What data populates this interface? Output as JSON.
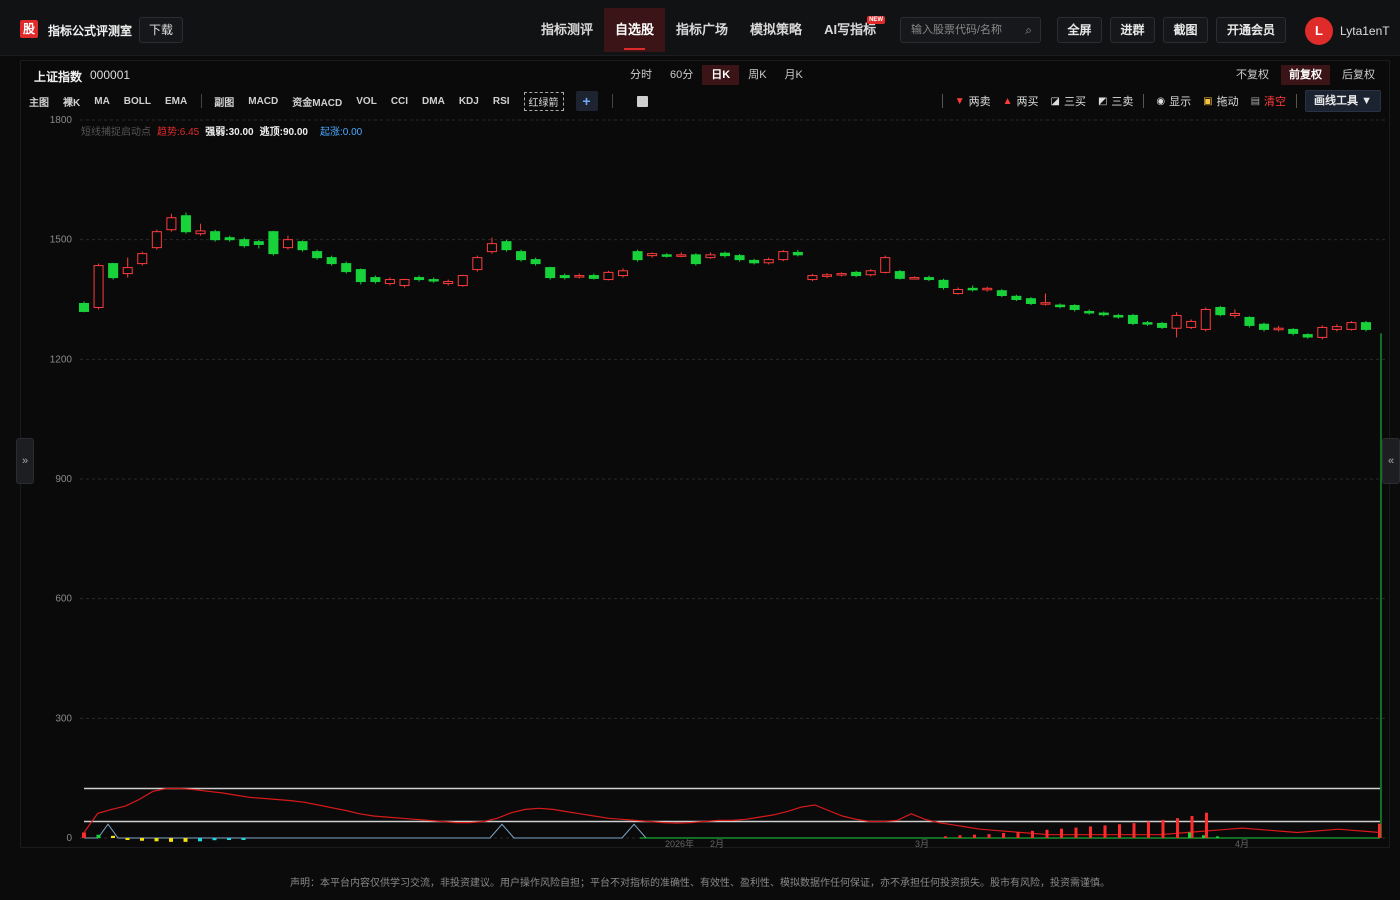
{
  "header": {
    "logo_text": "股",
    "app_title": "指标公式评测室",
    "download_label": "下载",
    "nav": [
      {
        "label": "指标测评",
        "active": false,
        "badge": ""
      },
      {
        "label": "自选股",
        "active": true,
        "badge": ""
      },
      {
        "label": "指标广场",
        "active": false,
        "badge": ""
      },
      {
        "label": "模拟策略",
        "active": false,
        "badge": ""
      },
      {
        "label": "AI写指标",
        "active": false,
        "badge": "NEW"
      }
    ],
    "search_placeholder": "输入股票代码/名称",
    "buttons": {
      "fullscreen": "全屏",
      "join_group": "进群",
      "screenshot": "截图",
      "vip": "开通会员"
    },
    "avatar_letter": "L",
    "username": "Lyta1enT"
  },
  "stock": {
    "name": "上证指数",
    "code": "000001"
  },
  "periods": [
    "分时",
    "60分",
    "日K",
    "周K",
    "月K"
  ],
  "active_period": "日K",
  "adjust": [
    "不复权",
    "前复权",
    "后复权"
  ],
  "active_adjust": "前复权",
  "indicators_main": [
    "主图",
    "裸K",
    "MA",
    "BOLL",
    "EMA"
  ],
  "indicators_sub": [
    "副图",
    "MACD",
    "资金MACD",
    "VOL",
    "CCI",
    "DMA",
    "KDJ",
    "RSI"
  ],
  "indicator_special": "红绿箭",
  "draw_tools": {
    "sell2": "两卖",
    "buy2": "两买",
    "buy3": "三买",
    "sell3": "三卖",
    "show": "显示",
    "drag": "拖动",
    "clear": "清空",
    "tool_btn": "画线工具 ▼"
  },
  "legend": {
    "name": "短线捕捉启动点",
    "trend": "趋势:6.45",
    "strong_weak": "强弱:30.00",
    "top": "逃顶:90.00",
    "hidden": "",
    "rise": "起涨:0.00"
  },
  "colors": {
    "up": "#ff3b3b",
    "down": "#18d23a",
    "accent": "#e02b2b",
    "blue": "#4aa8ff"
  },
  "chart_data": {
    "type": "candlestick",
    "yticks": [
      0,
      300,
      600,
      900,
      1200,
      1500,
      1800
    ],
    "ylim": [
      0,
      1800
    ],
    "x_labels": [
      "2026年",
      "2月",
      "3月",
      "4月"
    ],
    "candles": [
      {
        "o": 1340,
        "c": 1320,
        "h": 1345,
        "l": 1318
      },
      {
        "o": 1330,
        "c": 1435,
        "h": 1440,
        "l": 1325
      },
      {
        "o": 1440,
        "c": 1405,
        "h": 1442,
        "l": 1400
      },
      {
        "o": 1415,
        "c": 1430,
        "h": 1455,
        "l": 1405
      },
      {
        "o": 1440,
        "c": 1465,
        "h": 1470,
        "l": 1435
      },
      {
        "o": 1480,
        "c": 1520,
        "h": 1525,
        "l": 1475
      },
      {
        "o": 1525,
        "c": 1555,
        "h": 1565,
        "l": 1520
      },
      {
        "o": 1560,
        "c": 1520,
        "h": 1568,
        "l": 1515
      },
      {
        "o": 1515,
        "c": 1522,
        "h": 1540,
        "l": 1510
      },
      {
        "o": 1520,
        "c": 1500,
        "h": 1525,
        "l": 1495
      },
      {
        "o": 1505,
        "c": 1500,
        "h": 1510,
        "l": 1495
      },
      {
        "o": 1500,
        "c": 1485,
        "h": 1505,
        "l": 1480
      },
      {
        "o": 1495,
        "c": 1488,
        "h": 1500,
        "l": 1478
      },
      {
        "o": 1520,
        "c": 1465,
        "h": 1522,
        "l": 1460
      },
      {
        "o": 1480,
        "c": 1500,
        "h": 1510,
        "l": 1475
      },
      {
        "o": 1495,
        "c": 1475,
        "h": 1498,
        "l": 1470
      },
      {
        "o": 1470,
        "c": 1455,
        "h": 1475,
        "l": 1450
      },
      {
        "o": 1455,
        "c": 1440,
        "h": 1460,
        "l": 1435
      },
      {
        "o": 1440,
        "c": 1420,
        "h": 1445,
        "l": 1415
      },
      {
        "o": 1425,
        "c": 1395,
        "h": 1428,
        "l": 1388
      },
      {
        "o": 1405,
        "c": 1395,
        "h": 1410,
        "l": 1390
      },
      {
        "o": 1390,
        "c": 1400,
        "h": 1405,
        "l": 1385
      },
      {
        "o": 1385,
        "c": 1400,
        "h": 1402,
        "l": 1380
      },
      {
        "o": 1405,
        "c": 1400,
        "h": 1410,
        "l": 1395
      },
      {
        "o": 1400,
        "c": 1398,
        "h": 1405,
        "l": 1392
      },
      {
        "o": 1390,
        "c": 1395,
        "h": 1400,
        "l": 1385
      },
      {
        "o": 1385,
        "c": 1410,
        "h": 1412,
        "l": 1382
      },
      {
        "o": 1425,
        "c": 1455,
        "h": 1460,
        "l": 1420
      },
      {
        "o": 1470,
        "c": 1490,
        "h": 1505,
        "l": 1465
      },
      {
        "o": 1495,
        "c": 1475,
        "h": 1500,
        "l": 1470
      },
      {
        "o": 1470,
        "c": 1450,
        "h": 1475,
        "l": 1445
      },
      {
        "o": 1450,
        "c": 1440,
        "h": 1455,
        "l": 1435
      },
      {
        "o": 1430,
        "c": 1405,
        "h": 1432,
        "l": 1400
      },
      {
        "o": 1410,
        "c": 1405,
        "h": 1415,
        "l": 1400
      },
      {
        "o": 1408,
        "c": 1410,
        "h": 1415,
        "l": 1403
      },
      {
        "o": 1410,
        "c": 1403,
        "h": 1415,
        "l": 1400
      },
      {
        "o": 1400,
        "c": 1418,
        "h": 1422,
        "l": 1398
      },
      {
        "o": 1410,
        "c": 1422,
        "h": 1428,
        "l": 1405
      },
      {
        "o": 1470,
        "c": 1450,
        "h": 1475,
        "l": 1445
      },
      {
        "o": 1460,
        "c": 1465,
        "h": 1468,
        "l": 1455
      },
      {
        "o": 1462,
        "c": 1460,
        "h": 1466,
        "l": 1455
      },
      {
        "o": 1460,
        "c": 1462,
        "h": 1468,
        "l": 1456
      },
      {
        "o": 1462,
        "c": 1440,
        "h": 1466,
        "l": 1435
      },
      {
        "o": 1455,
        "c": 1462,
        "h": 1468,
        "l": 1452
      },
      {
        "o": 1466,
        "c": 1460,
        "h": 1470,
        "l": 1455
      },
      {
        "o": 1460,
        "c": 1450,
        "h": 1464,
        "l": 1445
      },
      {
        "o": 1448,
        "c": 1442,
        "h": 1452,
        "l": 1438
      },
      {
        "o": 1442,
        "c": 1450,
        "h": 1455,
        "l": 1438
      },
      {
        "o": 1450,
        "c": 1470,
        "h": 1474,
        "l": 1446
      },
      {
        "o": 1468,
        "c": 1462,
        "h": 1474,
        "l": 1458
      },
      {
        "o": 1400,
        "c": 1410,
        "h": 1414,
        "l": 1396
      },
      {
        "o": 1408,
        "c": 1412,
        "h": 1416,
        "l": 1404
      },
      {
        "o": 1412,
        "c": 1415,
        "h": 1418,
        "l": 1408
      },
      {
        "o": 1418,
        "c": 1410,
        "h": 1422,
        "l": 1406
      },
      {
        "o": 1412,
        "c": 1422,
        "h": 1426,
        "l": 1408
      },
      {
        "o": 1418,
        "c": 1455,
        "h": 1460,
        "l": 1415
      },
      {
        "o": 1420,
        "c": 1403,
        "h": 1424,
        "l": 1400
      },
      {
        "o": 1403,
        "c": 1405,
        "h": 1408,
        "l": 1400
      },
      {
        "o": 1405,
        "c": 1400,
        "h": 1410,
        "l": 1396
      },
      {
        "o": 1398,
        "c": 1380,
        "h": 1402,
        "l": 1375
      },
      {
        "o": 1365,
        "c": 1375,
        "h": 1380,
        "l": 1362
      },
      {
        "o": 1378,
        "c": 1375,
        "h": 1385,
        "l": 1370
      },
      {
        "o": 1375,
        "c": 1378,
        "h": 1382,
        "l": 1370
      },
      {
        "o": 1372,
        "c": 1360,
        "h": 1376,
        "l": 1356
      },
      {
        "o": 1358,
        "c": 1350,
        "h": 1362,
        "l": 1346
      },
      {
        "o": 1352,
        "c": 1340,
        "h": 1356,
        "l": 1336
      },
      {
        "o": 1340,
        "c": 1342,
        "h": 1365,
        "l": 1335
      },
      {
        "o": 1336,
        "c": 1332,
        "h": 1340,
        "l": 1328
      },
      {
        "o": 1335,
        "c": 1325,
        "h": 1338,
        "l": 1320
      },
      {
        "o": 1320,
        "c": 1318,
        "h": 1325,
        "l": 1312
      },
      {
        "o": 1316,
        "c": 1312,
        "h": 1320,
        "l": 1308
      },
      {
        "o": 1310,
        "c": 1306,
        "h": 1314,
        "l": 1302
      },
      {
        "o": 1310,
        "c": 1290,
        "h": 1314,
        "l": 1286
      },
      {
        "o": 1292,
        "c": 1290,
        "h": 1296,
        "l": 1284
      },
      {
        "o": 1290,
        "c": 1280,
        "h": 1294,
        "l": 1276
      },
      {
        "o": 1278,
        "c": 1310,
        "h": 1318,
        "l": 1255
      },
      {
        "o": 1280,
        "c": 1295,
        "h": 1300,
        "l": 1276
      },
      {
        "o": 1275,
        "c": 1325,
        "h": 1330,
        "l": 1270
      },
      {
        "o": 1330,
        "c": 1312,
        "h": 1334,
        "l": 1308
      },
      {
        "o": 1310,
        "c": 1315,
        "h": 1325,
        "l": 1304
      },
      {
        "o": 1305,
        "c": 1285,
        "h": 1308,
        "l": 1280
      },
      {
        "o": 1288,
        "c": 1275,
        "h": 1292,
        "l": 1270
      },
      {
        "o": 1275,
        "c": 1278,
        "h": 1284,
        "l": 1270
      },
      {
        "o": 1275,
        "c": 1265,
        "h": 1278,
        "l": 1260
      },
      {
        "o": 1262,
        "c": 1256,
        "h": 1265,
        "l": 1252
      },
      {
        "o": 1255,
        "c": 1280,
        "h": 1285,
        "l": 1250
      },
      {
        "o": 1275,
        "c": 1282,
        "h": 1288,
        "l": 1270
      },
      {
        "o": 1275,
        "c": 1292,
        "h": 1296,
        "l": 1272
      },
      {
        "o": 1292,
        "c": 1275,
        "h": 1296,
        "l": 1270
      }
    ],
    "osc_levels": [
      90,
      30
    ],
    "trend_line": [
      10,
      45,
      52,
      58,
      70,
      85,
      90,
      90,
      88,
      85,
      82,
      78,
      74,
      72,
      70,
      68,
      65,
      60,
      55,
      50,
      44,
      40,
      38,
      36,
      34,
      32,
      30,
      28,
      28,
      30,
      36,
      46,
      52,
      54,
      52,
      48,
      44,
      40,
      36,
      34,
      32,
      30,
      28,
      27,
      28,
      30,
      32,
      32,
      34,
      38,
      42,
      48,
      56,
      60,
      50,
      40,
      34,
      30,
      30,
      32,
      44,
      34,
      28,
      24,
      20,
      16,
      14,
      12,
      10,
      8,
      6,
      6,
      6,
      6,
      6,
      6,
      6,
      6,
      6,
      8,
      10,
      12,
      14,
      16,
      18,
      16,
      14,
      12,
      10,
      12,
      14,
      16,
      14,
      12,
      10
    ],
    "strong_line": [
      0,
      8,
      30,
      10,
      0,
      0,
      0,
      0,
      0,
      0,
      0,
      0,
      0,
      0,
      0,
      0,
      0,
      0,
      0,
      0,
      0,
      0,
      0,
      0,
      0,
      0,
      0,
      0,
      0,
      0,
      0,
      0,
      0,
      0,
      0,
      0,
      0,
      0,
      0,
      0,
      0,
      0,
      0,
      0,
      0,
      0,
      0,
      0,
      0,
      0,
      0,
      0,
      0,
      0,
      0,
      0,
      0,
      0,
      0,
      0,
      0,
      0,
      0,
      0,
      0,
      0,
      0,
      0,
      0,
      0,
      0,
      0,
      0,
      0,
      0,
      0,
      0,
      0,
      0,
      0,
      0,
      0,
      0,
      0,
      0,
      0,
      0,
      0,
      0,
      0,
      0
    ],
    "bars": [
      {
        "v": 10,
        "c": "red"
      },
      {
        "v": 6,
        "c": "green"
      },
      {
        "v": 4,
        "c": "yellow"
      },
      {
        "v": -3,
        "c": "yellow"
      },
      {
        "v": -5,
        "c": "yellow"
      },
      {
        "v": -6,
        "c": "yellow"
      },
      {
        "v": -7,
        "c": "yellow"
      },
      {
        "v": -7,
        "c": "yellow"
      },
      {
        "v": -6,
        "c": "cyan"
      },
      {
        "v": -4,
        "c": "cyan"
      },
      {
        "v": -2,
        "c": "cyan"
      },
      {
        "v": -1,
        "c": "cyan"
      }
    ],
    "red_bars": [
      3,
      5,
      6,
      7,
      9,
      11,
      13,
      15,
      17,
      19,
      21,
      23,
      25,
      27,
      30,
      33,
      36,
      40,
      46
    ],
    "last_price_line": 1265
  },
  "disclaimer": "声明：本平台内容仅供学习交流，非投资建议。用户操作风险自担；平台不对指标的准确性、有效性、盈利性、模拟数据作任何保证，亦不承担任何投资损失。股市有风险，投资需谨慎。"
}
